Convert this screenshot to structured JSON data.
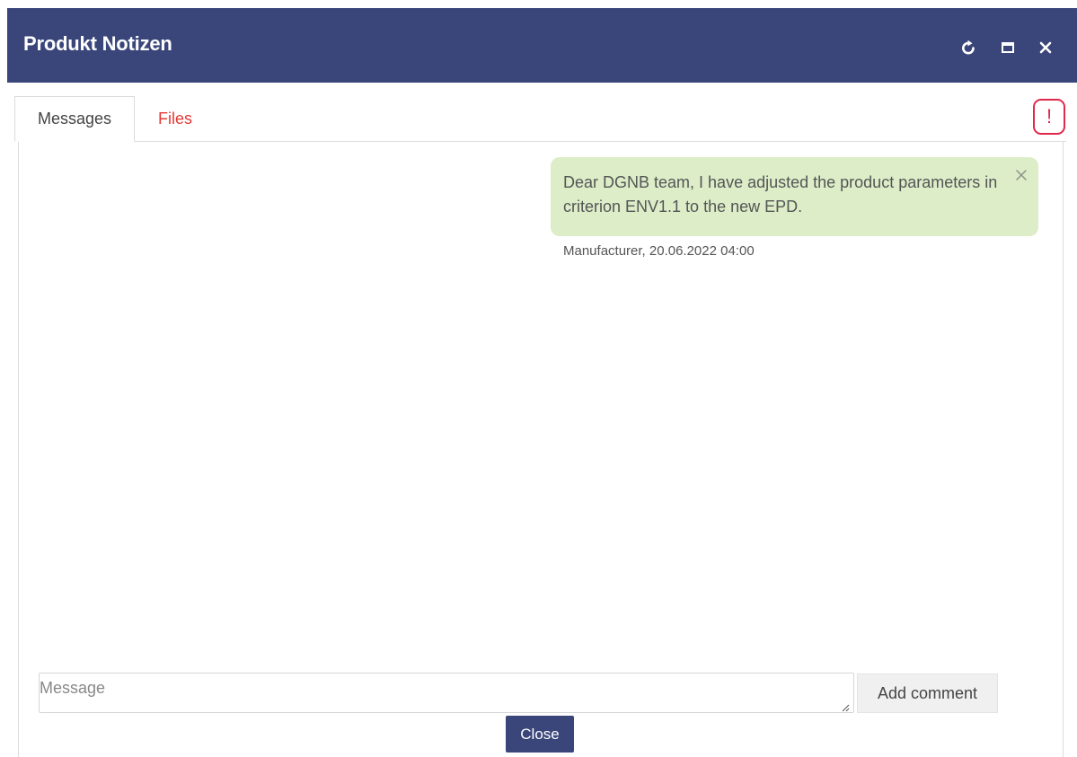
{
  "window": {
    "title": "Produkt Notizen",
    "controls": [
      "refresh-icon",
      "maximize-icon",
      "close-icon"
    ]
  },
  "tabs": [
    {
      "label": "Messages",
      "active": true
    },
    {
      "label": "Files",
      "active": false,
      "color": "#e53935"
    }
  ],
  "alert": {
    "symbol": "!",
    "color": "#e0294a"
  },
  "messages": [
    {
      "text": "Dear DGNB team, I have adjusted the product parameters in criterion ENV1.1 to the new EPD.",
      "meta": "Manufacturer, 20.06.2022 04:00"
    }
  ],
  "composer": {
    "placeholder": "Message",
    "value": "",
    "submit_label": "Add comment"
  },
  "footer": {
    "close_label": "Close"
  },
  "colors": {
    "header_bg": "#3a467a",
    "bubble_bg": "#dcedc8",
    "accent_red": "#e53935"
  }
}
